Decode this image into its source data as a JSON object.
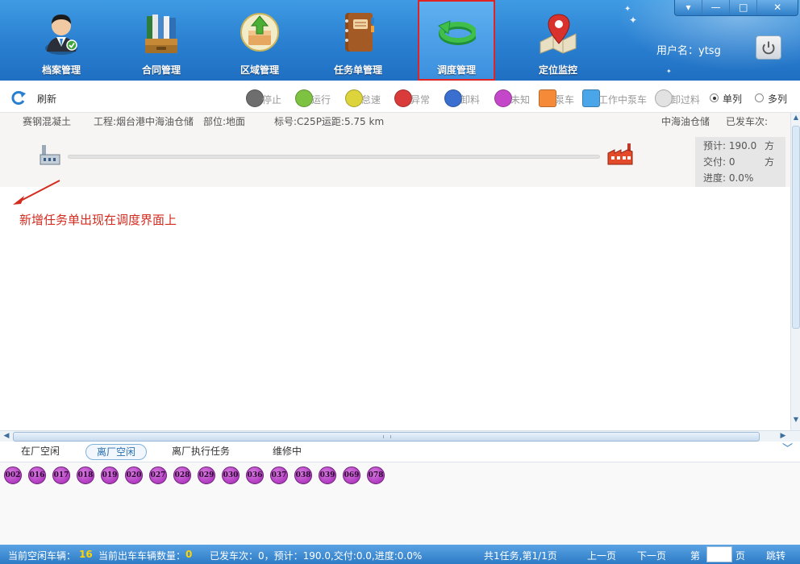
{
  "nav": {
    "items": [
      {
        "label": "档案管理",
        "icon": "user-avatar-icon"
      },
      {
        "label": "合同管理",
        "icon": "binders-icon"
      },
      {
        "label": "区域管理",
        "icon": "upload-box-icon"
      },
      {
        "label": "任务单管理",
        "icon": "notebook-icon"
      },
      {
        "label": "调度管理",
        "icon": "dispatch-arrow-icon"
      },
      {
        "label": "定位监控",
        "icon": "map-pin-icon"
      }
    ],
    "active_index": 4
  },
  "header": {
    "username": "用户名：ytsg"
  },
  "window_controls": {
    "dropdown": "▾",
    "minimize": "—",
    "maximize": "□",
    "close": "✕"
  },
  "toolbar": {
    "refresh_label": "刷新",
    "legend": [
      {
        "label": "停止",
        "color": "#6e6e6e",
        "shape": "circle"
      },
      {
        "label": "运行",
        "color": "#7dc241",
        "shape": "circle"
      },
      {
        "label": "怠速",
        "color": "#dcd43a",
        "shape": "circle"
      },
      {
        "label": "异常",
        "color": "#d93a3a",
        "shape": "circle"
      },
      {
        "label": "卸料",
        "color": "#3a6fd0",
        "shape": "circle"
      },
      {
        "label": "未知",
        "color": "#c447c9",
        "shape": "circle"
      },
      {
        "label": "泵车",
        "color": "#f58b38",
        "shape": "square"
      },
      {
        "label": "工作中泵车",
        "color": "#4aa6e8",
        "shape": "square"
      },
      {
        "label": "卸过料",
        "color": "#e2e2e2",
        "shape": "circle"
      }
    ],
    "view_single": "单列",
    "view_multi": "多列",
    "view_selected": "单列"
  },
  "task": {
    "product": "赛钢混凝土",
    "project": "工程:烟台港中海油仓储",
    "position": "部位:地面",
    "grade_distance": "标号:C25P运距:5.75   km",
    "site": "中海油仓储",
    "dispatched": "已发车次:",
    "planned_label": "预计: 190.0",
    "planned_unit": "方",
    "delivered_label": "交付: 0",
    "delivered_unit": "方",
    "progress_label": "进度: 0.0%",
    "progress": 0.0
  },
  "annotation": {
    "text": "新增任务单出现在调度界面上",
    "color": "#d42b1f"
  },
  "tabs": {
    "items": [
      "在厂空闲",
      "离厂空闲",
      "离厂执行任务",
      "维修中"
    ],
    "active_index": 1
  },
  "vehicles": [
    "002",
    "016",
    "017",
    "018",
    "019",
    "020",
    "027",
    "028",
    "029",
    "030",
    "036",
    "037",
    "038",
    "039",
    "069",
    "078"
  ],
  "status": {
    "idle_label": "当前空闲车辆：",
    "idle_count": "16",
    "out_label": "当前出车车辆数量：",
    "out_count": "0",
    "summary": "已发车次：0，预计：190.0,交付:0.0,进度:0.0%",
    "page_info": "共1任务,第1/1页",
    "prev": "上一页",
    "next": "下一页",
    "page_prefix": "第",
    "page_suffix": "页",
    "jump": "跳转",
    "page_value": ""
  },
  "colors": {
    "banner": "#2a7fd0",
    "active_border": "#e02424",
    "vehicle": "#b13cc0",
    "highlight_number": "#ffd400"
  }
}
